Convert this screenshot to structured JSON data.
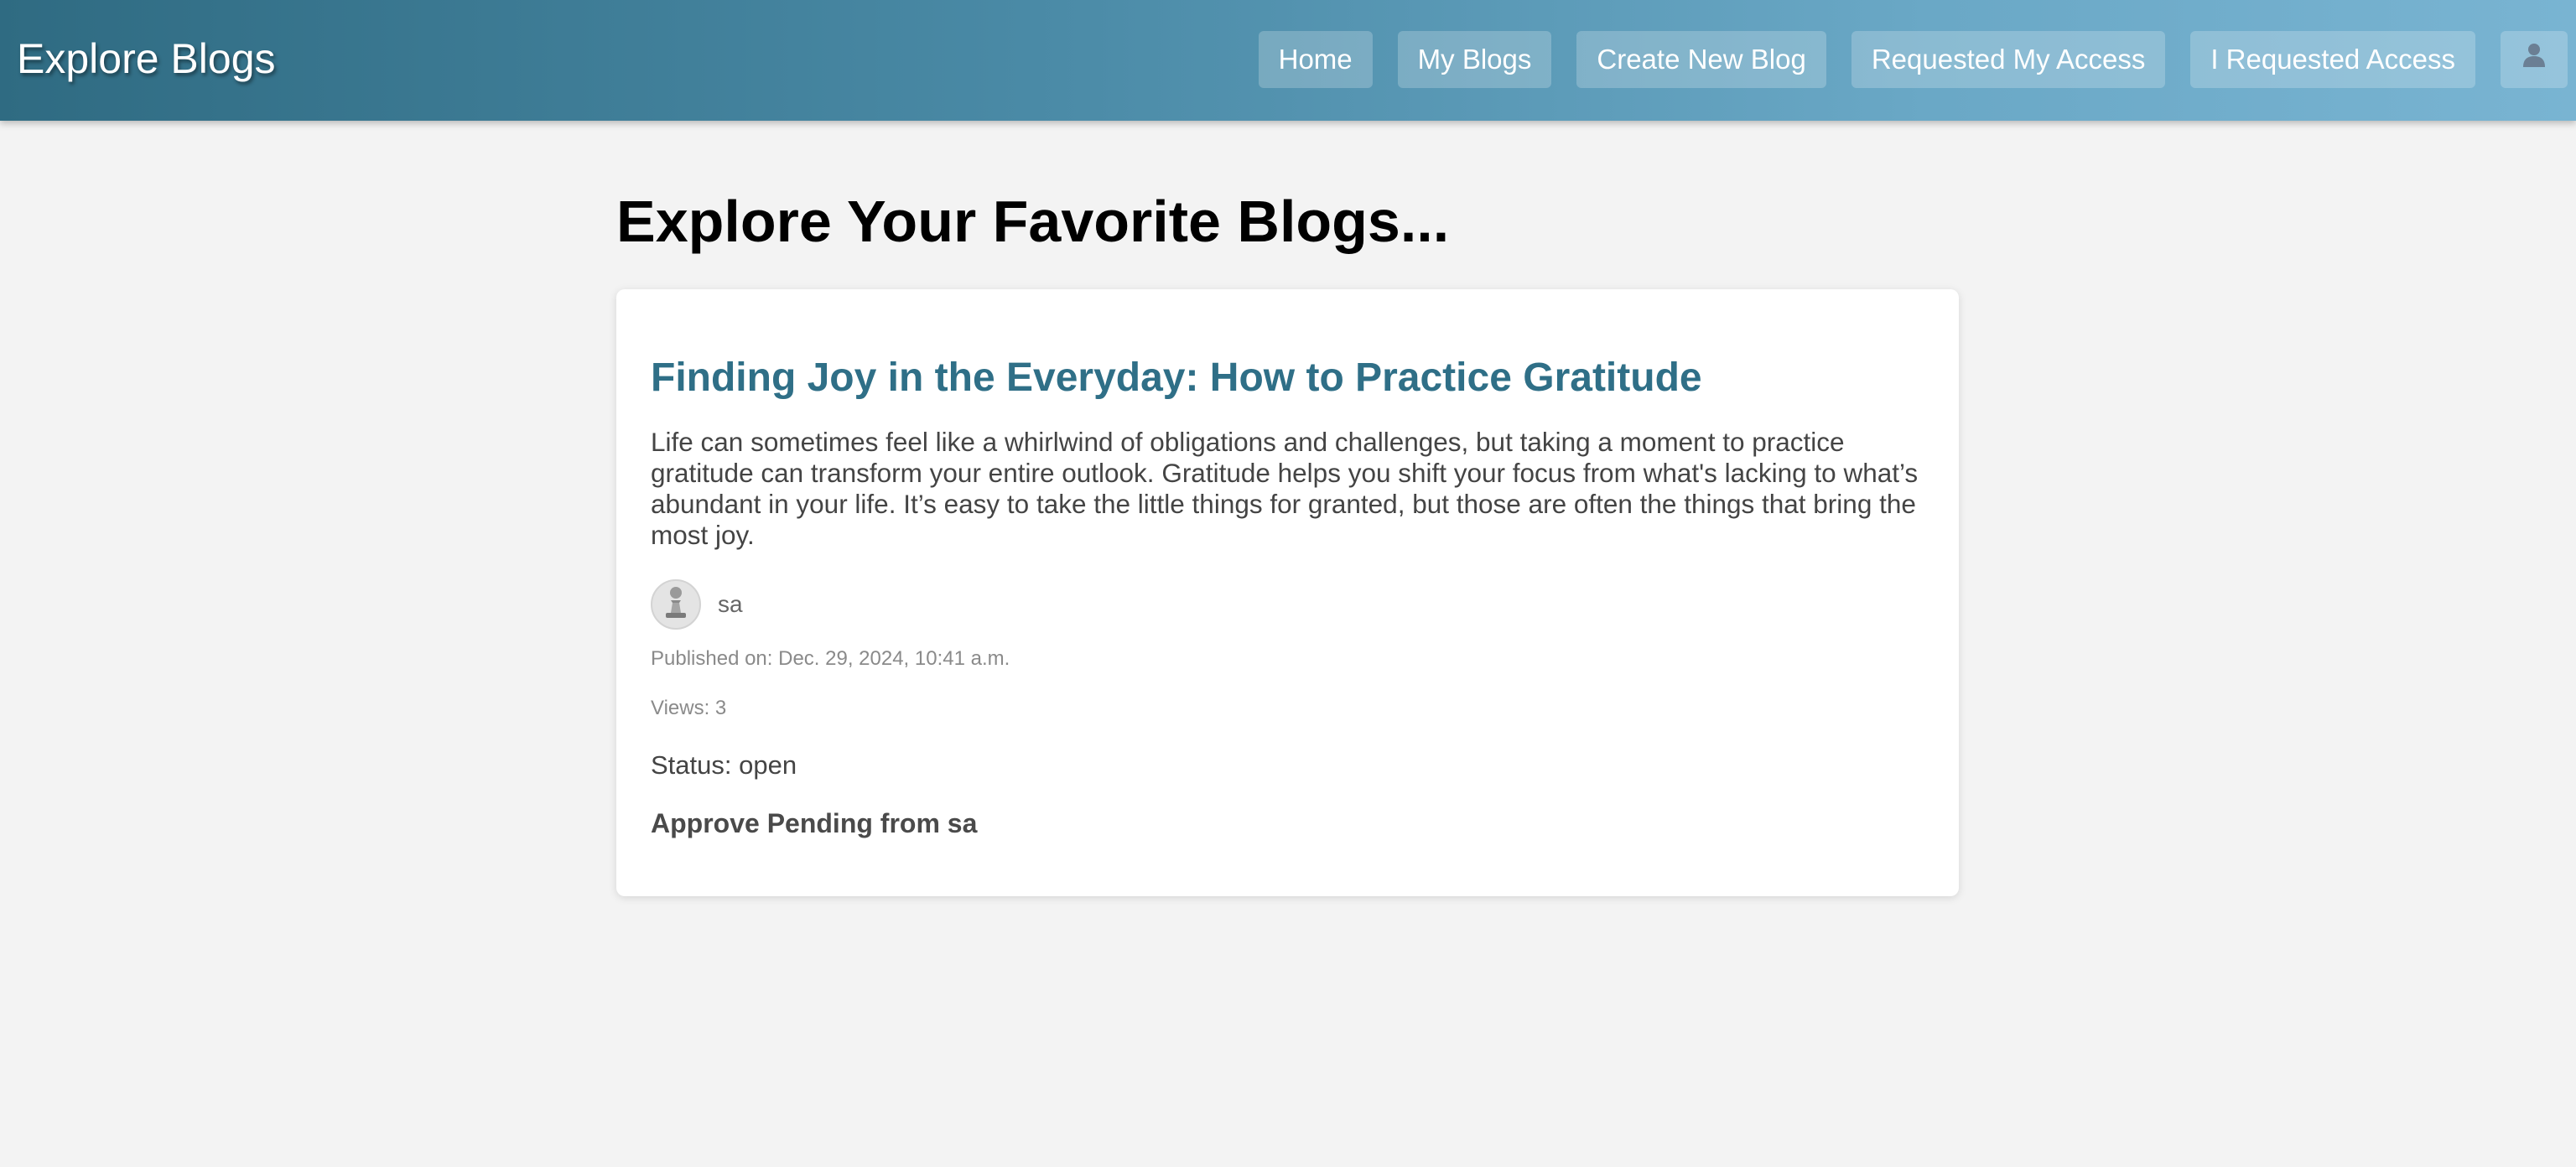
{
  "header": {
    "brand": "Explore Blogs",
    "nav": [
      {
        "label": "Home"
      },
      {
        "label": "My Blogs"
      },
      {
        "label": "Create New Blog"
      },
      {
        "label": "Requested My Access"
      },
      {
        "label": "I Requested Access"
      }
    ],
    "profile_icon": "user-profile-icon"
  },
  "main": {
    "page_title": "Explore Your Favorite Blogs...",
    "blog": {
      "title": "Finding Joy in the Everyday: How to Practice Gratitude",
      "excerpt": "Life can sometimes feel like a whirlwind of obligations and challenges, but taking a moment to practice gratitude can transform your entire outlook. Gratitude helps you shift your focus from what's lacking to what’s abundant in your life. It’s easy to take the little things for granted, but those are often the things that bring the most joy.",
      "author": "sa",
      "published": "Published on: Dec. 29, 2024, 10:41 a.m.",
      "views": "Views: 3",
      "status": "Status: open",
      "approval": "Approve Pending from sa"
    }
  },
  "colors": {
    "header_start": "#2f6b82",
    "header_end": "#79b4d2",
    "title_link": "#2f6f87",
    "background": "#f3f3f3"
  }
}
